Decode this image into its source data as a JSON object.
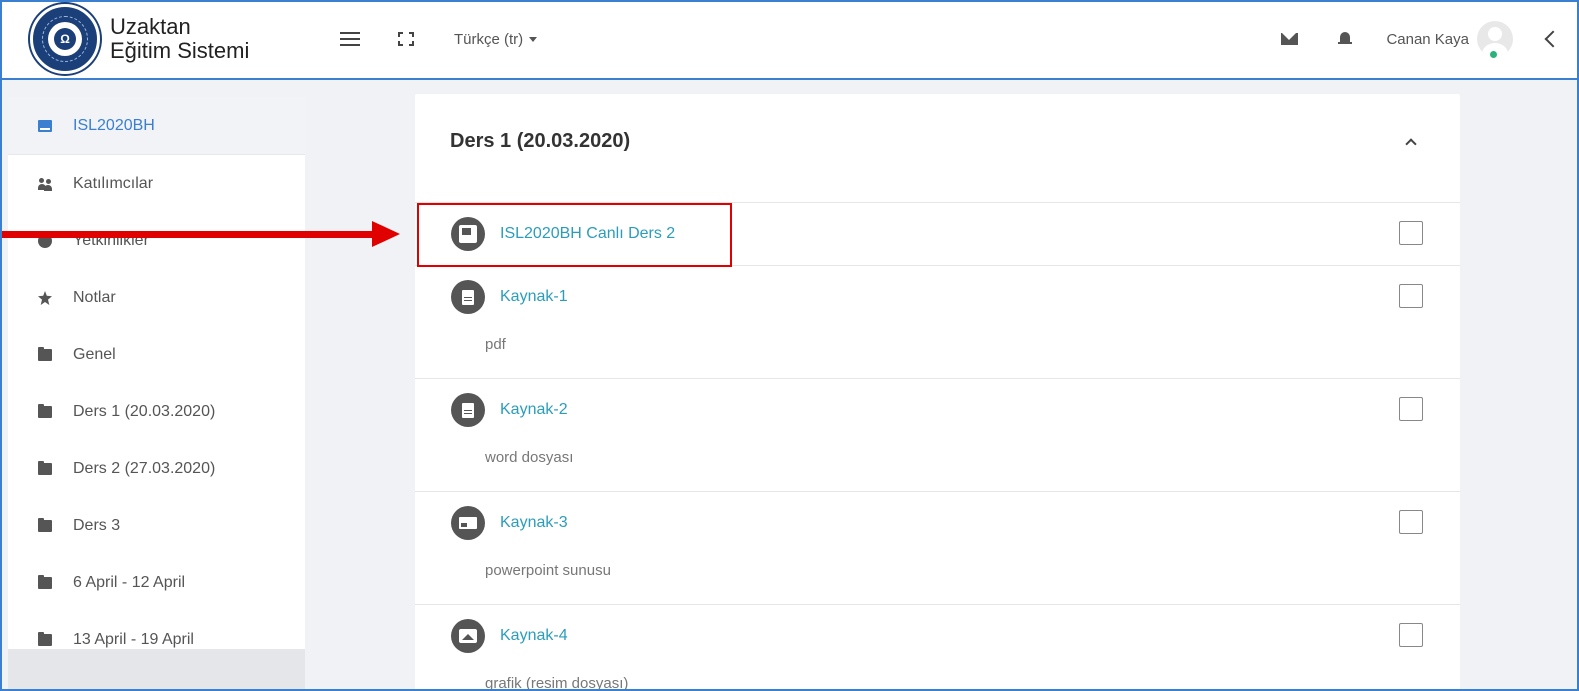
{
  "brand": {
    "line1": "Uzaktan",
    "line2": "Eğitim Sistemi"
  },
  "header": {
    "language": "Türkçe (tr)",
    "user_name": "Canan Kaya"
  },
  "sidebar": {
    "items": [
      {
        "label": "ISL2020BH",
        "icon": "book-icon",
        "active": true
      },
      {
        "label": "Katılımcılar",
        "icon": "users-icon"
      },
      {
        "label": "Yetkinlikler",
        "icon": "check-circle-icon"
      },
      {
        "label": "Notlar",
        "icon": "star-icon"
      },
      {
        "label": "Genel",
        "icon": "folder-icon"
      },
      {
        "label": "Ders 1 (20.03.2020)",
        "icon": "folder-icon"
      },
      {
        "label": "Ders 2 (27.03.2020)",
        "icon": "folder-icon"
      },
      {
        "label": "Ders 3",
        "icon": "folder-icon"
      },
      {
        "label": "6 April - 12 April",
        "icon": "folder-icon"
      },
      {
        "label": "13 April - 19 April",
        "icon": "folder-icon"
      }
    ]
  },
  "section": {
    "title": "Ders 1 (20.03.2020)",
    "activities": [
      {
        "name": "ISL2020BH Canlı Ders 2",
        "icon": "live-class-icon",
        "description": ""
      },
      {
        "name": "Kaynak-1",
        "icon": "document-icon",
        "description": "pdf"
      },
      {
        "name": "Kaynak-2",
        "icon": "document-icon",
        "description": "word dosyası"
      },
      {
        "name": "Kaynak-3",
        "icon": "presentation-icon",
        "description": "powerpoint sunusu"
      },
      {
        "name": "Kaynak-4",
        "icon": "image-icon",
        "description": "grafik (resim dosyası)"
      }
    ]
  },
  "colors": {
    "accent": "#3a7fd0",
    "link": "#2b9dbb",
    "annotation": "#e00000"
  }
}
